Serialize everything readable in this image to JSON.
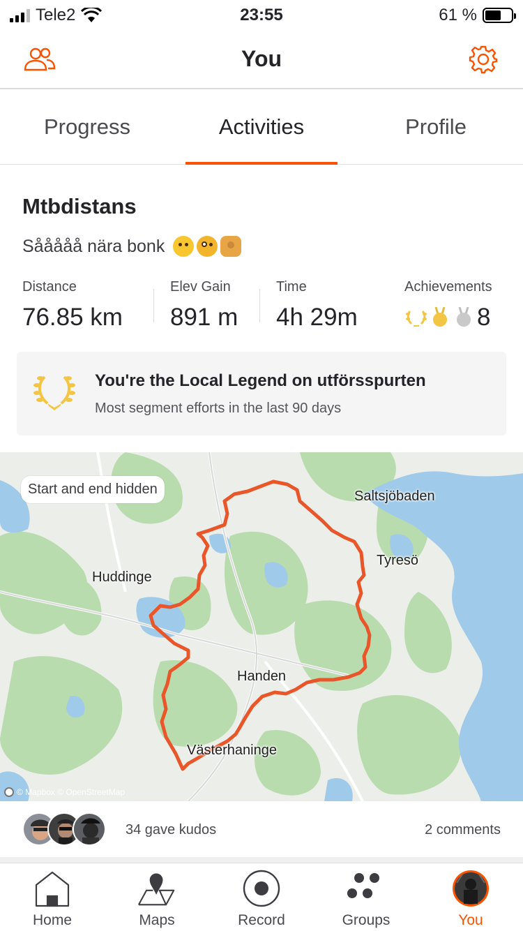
{
  "status_bar": {
    "carrier": "Tele2",
    "time": "23:55",
    "battery_percent": "61 %",
    "battery_level": 0.61
  },
  "header": {
    "title": "You",
    "left_icon": "people-icon",
    "right_icon": "gear-icon",
    "accent": "#fc5200"
  },
  "tabs": [
    {
      "label": "Progress",
      "active": false
    },
    {
      "label": "Activities",
      "active": true
    },
    {
      "label": "Profile",
      "active": false
    }
  ],
  "activity": {
    "title": "Mtbdistans",
    "description": "Sååååå nära bonk",
    "description_emojis": [
      "grinning-sweat-emoji",
      "zany-face-emoji",
      "shrug-emoji"
    ],
    "stats": [
      {
        "label": "Distance",
        "value": "76.85 km"
      },
      {
        "label": "Elev Gain",
        "value": "891 m"
      },
      {
        "label": "Time",
        "value": "4h 29m"
      },
      {
        "label": "Achievements",
        "value": "8"
      }
    ],
    "legend": {
      "title": "You're the Local Legend on utförsspurten",
      "subtitle": "Most segment efforts in the last 90 days"
    }
  },
  "map": {
    "badge": "Start and end hidden",
    "places": [
      "Saltsjöbaden",
      "Tyresö",
      "Huddinge",
      "Handen",
      "Västerhaninge"
    ],
    "attribution": "© Mapbox © OpenStreetMap",
    "route_color": "#e8562a"
  },
  "kudos": {
    "count_text": "34 gave kudos",
    "comments_text": "2 comments"
  },
  "tabbar": [
    {
      "label": "Home",
      "icon": "home-icon",
      "active": false
    },
    {
      "label": "Maps",
      "icon": "map-icon",
      "active": false
    },
    {
      "label": "Record",
      "icon": "record-icon",
      "active": false
    },
    {
      "label": "Groups",
      "icon": "groups-icon",
      "active": false
    },
    {
      "label": "You",
      "icon": "profile-avatar-icon",
      "active": true
    }
  ]
}
